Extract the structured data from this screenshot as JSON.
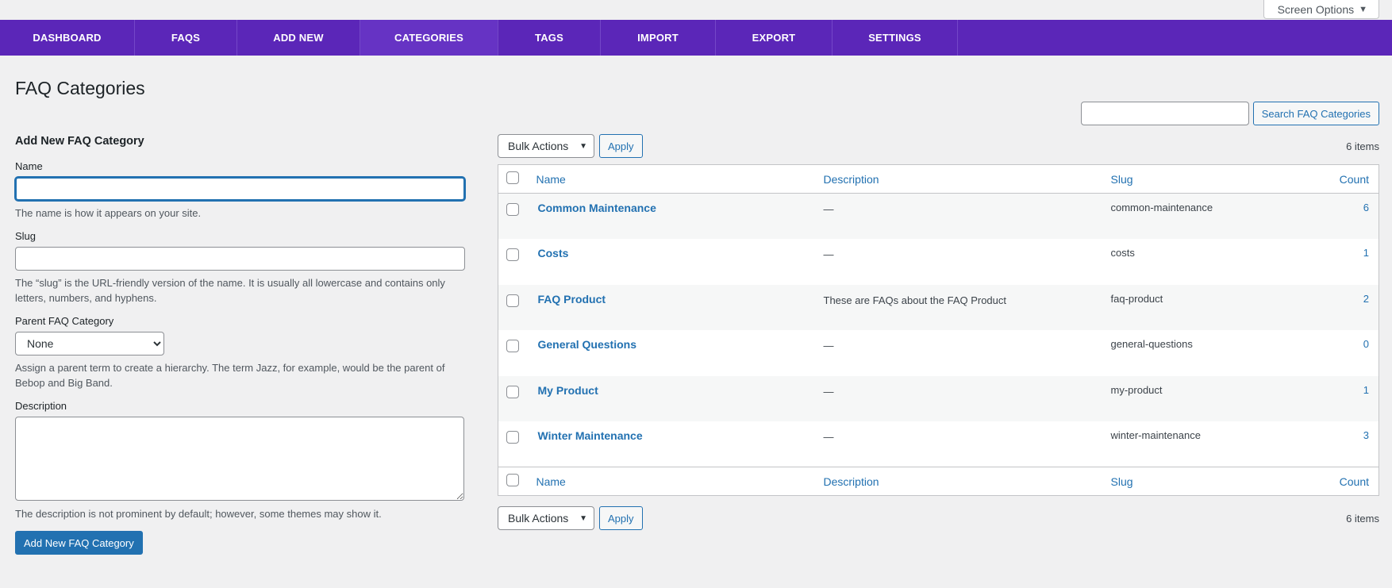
{
  "screen_options": {
    "label": "Screen Options",
    "arrow": "▼"
  },
  "nav": [
    {
      "label": "DASHBOARD",
      "active": false
    },
    {
      "label": "FAQS",
      "active": false
    },
    {
      "label": "ADD NEW",
      "active": false
    },
    {
      "label": "CATEGORIES",
      "active": true
    },
    {
      "label": "TAGS",
      "active": false
    },
    {
      "label": "IMPORT",
      "active": false
    },
    {
      "label": "EXPORT",
      "active": false
    },
    {
      "label": "SETTINGS",
      "active": false
    }
  ],
  "page_title": "FAQ Categories",
  "form": {
    "heading": "Add New FAQ Category",
    "name_label": "Name",
    "name_value": "",
    "name_help": "The name is how it appears on your site.",
    "slug_label": "Slug",
    "slug_value": "",
    "slug_help": "The “slug” is the URL-friendly version of the name. It is usually all lowercase and contains only letters, numbers, and hyphens.",
    "parent_label": "Parent FAQ Category",
    "parent_selected": "None",
    "parent_help": "Assign a parent term to create a hierarchy. The term Jazz, for example, would be the parent of Bebop and Big Band.",
    "desc_label": "Description",
    "desc_value": "",
    "desc_help": "The description is not prominent by default; however, some themes may show it.",
    "submit_label": "Add New FAQ Category"
  },
  "search": {
    "value": "",
    "button_label": "Search FAQ Categories"
  },
  "tablenav": {
    "bulk_label": "Bulk Actions",
    "apply_label": "Apply",
    "items_count": "6 items"
  },
  "table": {
    "columns": {
      "name": "Name",
      "description": "Description",
      "slug": "Slug",
      "count": "Count"
    },
    "rows": [
      {
        "name": "Common Maintenance",
        "description": "—",
        "slug": "common-maintenance",
        "count": "6"
      },
      {
        "name": "Costs",
        "description": "—",
        "slug": "costs",
        "count": "1"
      },
      {
        "name": "FAQ Product",
        "description": "These are FAQs about the FAQ Product",
        "slug": "faq-product",
        "count": "2"
      },
      {
        "name": "General Questions",
        "description": "—",
        "slug": "general-questions",
        "count": "0"
      },
      {
        "name": "My Product",
        "description": "—",
        "slug": "my-product",
        "count": "1"
      },
      {
        "name": "Winter Maintenance",
        "description": "—",
        "slug": "winter-maintenance",
        "count": "3"
      }
    ]
  },
  "colors": {
    "nav_bg": "#5b26b8",
    "nav_active": "#6633c4",
    "link": "#2271b1",
    "page_bg": "#f0f0f1"
  }
}
